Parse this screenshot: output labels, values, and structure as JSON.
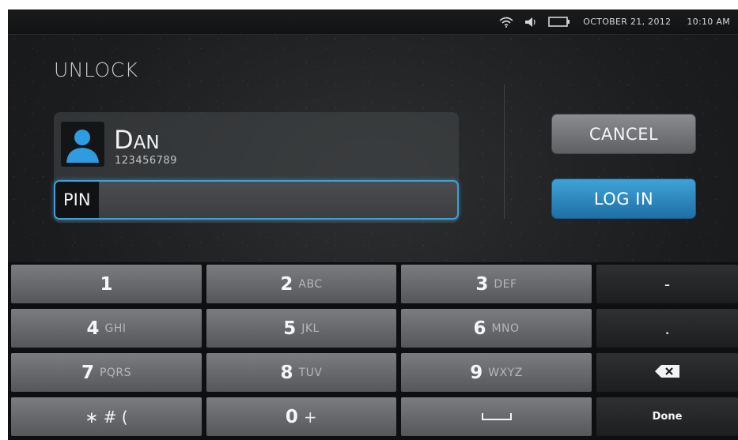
{
  "status_bar": {
    "icons": [
      "wifi-icon",
      "volume-icon",
      "battery-icon"
    ],
    "date": "OCTOBER 21, 2012",
    "time": "10:10 AM"
  },
  "title": "UNLOCK",
  "user": {
    "name_initial": "D",
    "name_rest": "AN",
    "id": "123456789",
    "avatar_icon": "person-icon"
  },
  "pin": {
    "label": "PIN",
    "value": ""
  },
  "buttons": {
    "cancel": "CANCEL",
    "login": "LOG IN"
  },
  "keypad": {
    "rows": [
      [
        {
          "digit": "1",
          "letters": ""
        },
        {
          "digit": "2",
          "letters": "ABC"
        },
        {
          "digit": "3",
          "letters": "DEF"
        },
        {
          "fn": "-"
        }
      ],
      [
        {
          "digit": "4",
          "letters": "GHI"
        },
        {
          "digit": "5",
          "letters": "JKL"
        },
        {
          "digit": "6",
          "letters": "MNO"
        },
        {
          "fn": "."
        }
      ],
      [
        {
          "digit": "7",
          "letters": "PQRS"
        },
        {
          "digit": "8",
          "letters": "TUV"
        },
        {
          "digit": "9",
          "letters": "WXYZ"
        },
        {
          "fn_icon": "backspace-icon"
        }
      ],
      [
        {
          "sym": "∗ # ("
        },
        {
          "digit": "0",
          "letters": "+"
        },
        {
          "fn_icon": "space-icon"
        },
        {
          "fn": "Done"
        }
      ]
    ]
  },
  "colors": {
    "accent": "#3ea0d6",
    "avatar": "#2f9be0"
  }
}
